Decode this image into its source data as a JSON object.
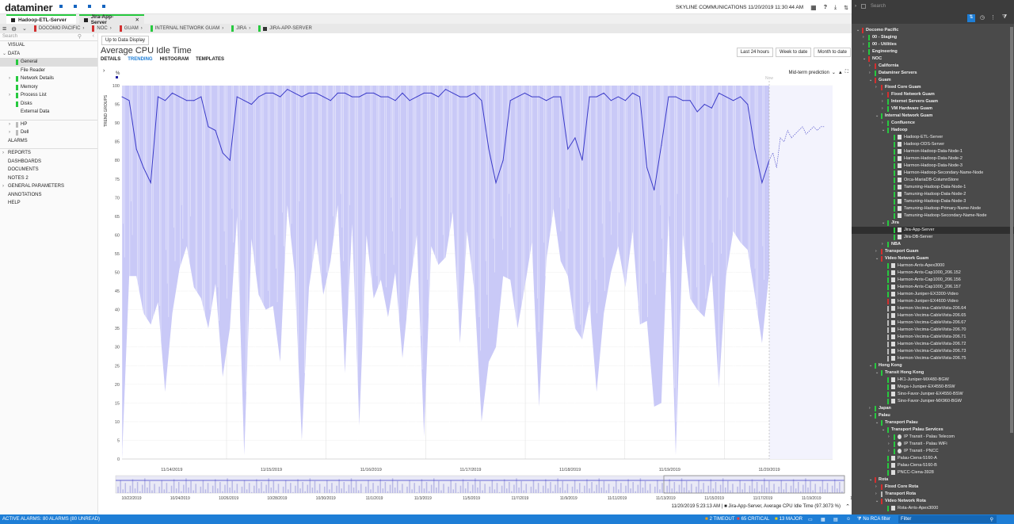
{
  "app": {
    "logo": "dataminer",
    "org_time": "SKYLINE COMMUNICATIONS 11/20/2019 11:30:44 AM"
  },
  "tabs": [
    {
      "label": "Hadoop-ETL-Server",
      "active": true
    },
    {
      "label": "Jira-App-Server",
      "active": false
    }
  ],
  "breadcrumbs": [
    "DOCOMO PACIFIC",
    "NOC",
    "GUAM",
    "INTERNAL NETWORK GUAM",
    "JIRA",
    "JIRA-APP-SERVER"
  ],
  "left_search": "Search",
  "left_nav": [
    {
      "label": "VISUAL",
      "indent": 0,
      "exp": "",
      "mark": ""
    },
    {
      "label": "DATA",
      "indent": 0,
      "exp": "⌄",
      "mark": ""
    },
    {
      "label": "General",
      "indent": 2,
      "exp": "",
      "mark": "#27c93f",
      "sel": true
    },
    {
      "label": "File Reader",
      "indent": 2,
      "exp": "",
      "mark": ""
    },
    {
      "label": "Network Details",
      "indent": 2,
      "exp": "›",
      "mark": "#27c93f"
    },
    {
      "label": "Memory",
      "indent": 2,
      "exp": "",
      "mark": "#27c93f"
    },
    {
      "label": "Process List",
      "indent": 2,
      "exp": "›",
      "mark": "#27c93f"
    },
    {
      "label": "Disks",
      "indent": 2,
      "exp": "",
      "mark": "#27c93f"
    },
    {
      "label": "External Data",
      "indent": 2,
      "exp": "",
      "mark": ""
    },
    {
      "label": "",
      "indent": 0,
      "exp": "",
      "mark": ""
    },
    {
      "label": "HP",
      "indent": 2,
      "exp": "›",
      "mark": "#bbb"
    },
    {
      "label": "Dell",
      "indent": 2,
      "exp": "›",
      "mark": "#bbb"
    },
    {
      "label": "ALARMS",
      "indent": 0,
      "exp": "",
      "mark": ""
    },
    {
      "label": "",
      "indent": 0,
      "exp": "",
      "mark": ""
    },
    {
      "label": "REPORTS",
      "indent": 0,
      "exp": "›",
      "mark": ""
    },
    {
      "label": "DASHBOARDS",
      "indent": 0,
      "exp": "",
      "mark": ""
    },
    {
      "label": "DOCUMENTS",
      "indent": 0,
      "exp": "",
      "mark": ""
    },
    {
      "label": "NOTES 2",
      "indent": 0,
      "exp": "",
      "mark": ""
    },
    {
      "label": "GENERAL PARAMETERS",
      "indent": 0,
      "exp": "›",
      "mark": ""
    },
    {
      "label": "ANNOTATIONS",
      "indent": 0,
      "exp": "",
      "mark": ""
    },
    {
      "label": "HELP",
      "indent": 0,
      "exp": "",
      "mark": ""
    }
  ],
  "toolbar": {
    "up_to_date": "Up to Data Display"
  },
  "page_title": "Average CPU Idle Time",
  "content_tabs": [
    "DETAILS",
    "TRENDING",
    "HISTOGRAM",
    "TEMPLATES"
  ],
  "range_buttons": [
    "Last 24 hours",
    "Week to date",
    "Month to date"
  ],
  "prediction": "Mid-term prediction",
  "trend_groups": "TREND GROUPS",
  "now": "Now",
  "chart_data": {
    "type": "line",
    "title": "",
    "ylabel": "%",
    "ylim": [
      0,
      100
    ],
    "yticks": [
      0,
      5,
      10,
      15,
      20,
      25,
      30,
      35,
      40,
      45,
      50,
      55,
      60,
      65,
      70,
      75,
      80,
      85,
      90,
      95,
      100
    ],
    "xticks": [
      "11/14/2019",
      "11/15/2019",
      "11/16/2019",
      "11/17/2019",
      "11/18/2019",
      "11/19/2019",
      "11/20/2019",
      "11/21/2019"
    ],
    "series": [
      {
        "name": "Jira-App-Server, Average CPU Idle Time",
        "color": "#3a3ac8",
        "values": [
          97,
          96,
          83,
          78,
          74,
          97,
          96,
          98,
          97,
          96,
          96,
          97,
          89,
          88,
          82,
          80,
          97,
          96,
          95,
          97,
          98,
          98,
          97,
          99,
          98,
          97,
          98,
          98,
          97,
          96,
          98,
          98,
          97,
          97,
          98,
          98,
          97,
          97,
          96,
          98,
          96,
          97,
          98,
          98,
          97,
          99,
          98,
          97,
          97,
          98,
          96,
          83,
          74,
          80,
          96,
          97,
          98,
          97,
          97,
          96,
          97,
          97,
          83,
          86,
          80,
          97,
          97,
          98,
          96,
          97,
          96,
          98,
          97,
          78,
          72,
          84,
          97,
          97,
          96,
          96,
          93,
          95,
          94,
          98,
          97,
          96,
          97,
          95,
          83,
          74,
          80
        ]
      }
    ],
    "prediction_values": [
      80,
      82,
      78,
      86,
      85,
      88,
      86,
      87,
      88,
      89,
      87,
      88,
      89,
      88,
      89,
      89
    ],
    "overview_ticks": [
      "10/22/2019",
      "10/24/2019",
      "10/26/2019",
      "10/28/2019",
      "10/30/2019",
      "11/1/2019",
      "11/3/2019",
      "11/5/2019",
      "11/7/2019",
      "11/9/2019",
      "11/11/2019",
      "11/13/2019",
      "11/15/2019",
      "11/17/2019",
      "11/19/2019",
      "11/21/2019"
    ]
  },
  "hover_info": "11/20/2019 5:23:13 AM | ■ Jira-App-Server, Average CPU Idle Time (97.3073 %)",
  "status": {
    "left": "ACTIVE ALARMS: 80 ALARMS (80 UNREAD)",
    "timeout": "2 TIMEOUT",
    "critical": "65 CRITICAL",
    "major": "13 MAJOR",
    "rca": "No RCA filter",
    "filter": "Filter"
  },
  "right_search": "Search",
  "right_tree": [
    {
      "label": "Docomo Pacific",
      "l": 0,
      "e": "⌄",
      "c": "#d32f2f",
      "b": 1
    },
    {
      "label": "00 - Staging",
      "l": 1,
      "e": "›",
      "c": "#27c93f",
      "b": 1
    },
    {
      "label": "00 - Utilities",
      "l": 1,
      "e": "›",
      "c": "#27c93f",
      "b": 1
    },
    {
      "label": "Engineering",
      "l": 1,
      "e": "›",
      "c": "#27c93f",
      "b": 1
    },
    {
      "label": "NOC",
      "l": 1,
      "e": "⌄",
      "c": "#d32f2f",
      "b": 1
    },
    {
      "label": "California",
      "l": 2,
      "e": "›",
      "c": "#d32f2f",
      "b": 1
    },
    {
      "label": "Dataminer Servers",
      "l": 2,
      "e": "›",
      "c": "#27c93f",
      "b": 1
    },
    {
      "label": "Guam",
      "l": 2,
      "e": "⌄",
      "c": "#d32f2f",
      "b": 1
    },
    {
      "label": "Fixed Core Guam",
      "l": 3,
      "e": "›",
      "c": "#d32f2f",
      "b": 1
    },
    {
      "label": "Fixed Network Guam",
      "l": 4,
      "e": "›",
      "c": "#d32f2f",
      "b": 1
    },
    {
      "label": "Internet Servers Guam",
      "l": 4,
      "e": "›",
      "c": "#27c93f",
      "b": 1
    },
    {
      "label": "VM Hardware Guam",
      "l": 4,
      "e": "›",
      "c": "#27c93f",
      "b": 1
    },
    {
      "label": "Internal Network Guam",
      "l": 3,
      "e": "⌄",
      "c": "#27c93f",
      "b": 1
    },
    {
      "label": "Confluence",
      "l": 4,
      "e": "›",
      "c": "#27c93f",
      "b": 1
    },
    {
      "label": "Hadoop",
      "l": 4,
      "e": "⌄",
      "c": "#27c93f",
      "b": 1
    },
    {
      "label": "Hadoop-ETL-Server",
      "l": 5,
      "e": "",
      "c": "#27c93f",
      "b": 0,
      "i": 1
    },
    {
      "label": "Hadoop-ODS-Server",
      "l": 5,
      "e": "",
      "c": "#27c93f",
      "b": 0,
      "i": 1
    },
    {
      "label": "Harmon-Hadoop-Data-Node-1",
      "l": 5,
      "e": "",
      "c": "#27c93f",
      "b": 0,
      "i": 1
    },
    {
      "label": "Harmon-Hadoop-Data-Node-2",
      "l": 5,
      "e": "",
      "c": "#27c93f",
      "b": 0,
      "i": 1
    },
    {
      "label": "Harmon-Hadoop-Data-Node-3",
      "l": 5,
      "e": "",
      "c": "#27c93f",
      "b": 0,
      "i": 1
    },
    {
      "label": "Harmon-Hadoop-Secondary-Name-Node",
      "l": 5,
      "e": "",
      "c": "#27c93f",
      "b": 0,
      "i": 1
    },
    {
      "label": "Orca-MariaDB-ColumnStore",
      "l": 5,
      "e": "",
      "c": "#27c93f",
      "b": 0,
      "i": 1
    },
    {
      "label": "Tamuning-Hadoop-Data-Node-1",
      "l": 5,
      "e": "",
      "c": "#27c93f",
      "b": 0,
      "i": 1
    },
    {
      "label": "Tamuning-Hadoop-Data-Node-2",
      "l": 5,
      "e": "",
      "c": "#27c93f",
      "b": 0,
      "i": 1
    },
    {
      "label": "Tamuning-Hadoop-Data-Node-3",
      "l": 5,
      "e": "",
      "c": "#27c93f",
      "b": 0,
      "i": 1
    },
    {
      "label": "Tamuning-Hadoop-Primary-Name-Node",
      "l": 5,
      "e": "",
      "c": "#27c93f",
      "b": 0,
      "i": 1
    },
    {
      "label": "Tamuning-Hadoop-Secondary-Name-Node",
      "l": 5,
      "e": "",
      "c": "#27c93f",
      "b": 0,
      "i": 1
    },
    {
      "label": "Jira",
      "l": 4,
      "e": "⌄",
      "c": "#27c93f",
      "b": 1
    },
    {
      "label": "Jira-App-Server",
      "l": 5,
      "e": "",
      "c": "#27c93f",
      "b": 0,
      "i": 1,
      "sel": 1
    },
    {
      "label": "Jira-DB-Server",
      "l": 5,
      "e": "",
      "c": "#27c93f",
      "b": 0,
      "i": 1
    },
    {
      "label": "NBA",
      "l": 4,
      "e": "›",
      "c": "#27c93f",
      "b": 1
    },
    {
      "label": "Transport Guam",
      "l": 3,
      "e": "›",
      "c": "#d32f2f",
      "b": 1
    },
    {
      "label": "Video Network Guam",
      "l": 3,
      "e": "⌄",
      "c": "#d32f2f",
      "b": 1
    },
    {
      "label": "Harmon-Arris-Apex3000",
      "l": 4,
      "e": "",
      "c": "#27c93f",
      "b": 0,
      "i": 1
    },
    {
      "label": "Harmon-Arris-Cap1000_206.152",
      "l": 4,
      "e": "",
      "c": "#27c93f",
      "b": 0,
      "i": 1
    },
    {
      "label": "Harmon-Arris-Cap1000_206.156",
      "l": 4,
      "e": "",
      "c": "#27c93f",
      "b": 0,
      "i": 1
    },
    {
      "label": "Harmon-Arris-Cap1000_206.157",
      "l": 4,
      "e": "",
      "c": "#27c93f",
      "b": 0,
      "i": 1
    },
    {
      "label": "Harmon-Juniper-EX3300-Video",
      "l": 4,
      "e": "",
      "c": "#27c93f",
      "b": 0,
      "i": 1
    },
    {
      "label": "Harmon-Juniper-EX4600-Video",
      "l": 4,
      "e": "",
      "c": "#d32f2f",
      "b": 0,
      "i": 1
    },
    {
      "label": "Harmon-Vecima-CableVista-206.64",
      "l": 4,
      "e": "",
      "c": "#bbb",
      "b": 0,
      "i": 1
    },
    {
      "label": "Harmon-Vecima-CableVista-206.65",
      "l": 4,
      "e": "",
      "c": "#bbb",
      "b": 0,
      "i": 1
    },
    {
      "label": "Harmon-Vecima-CableVista-206.67",
      "l": 4,
      "e": "",
      "c": "#bbb",
      "b": 0,
      "i": 1
    },
    {
      "label": "Harmon-Vecima-CableVista-206.70",
      "l": 4,
      "e": "",
      "c": "#bbb",
      "b": 0,
      "i": 1
    },
    {
      "label": "Harmon-Vecima-CableVista-206.71",
      "l": 4,
      "e": "",
      "c": "#bbb",
      "b": 0,
      "i": 1
    },
    {
      "label": "Harmon-Vecima-CableVista-206.72",
      "l": 4,
      "e": "",
      "c": "#bbb",
      "b": 0,
      "i": 1
    },
    {
      "label": "Harmon-Vecima-CableVista-206.73",
      "l": 4,
      "e": "",
      "c": "#bbb",
      "b": 0,
      "i": 1
    },
    {
      "label": "Harmon-Vecima-CableVista-206.75",
      "l": 4,
      "e": "",
      "c": "#bbb",
      "b": 0,
      "i": 1
    },
    {
      "label": "Hong Kong",
      "l": 2,
      "e": "⌄",
      "c": "#27c93f",
      "b": 1
    },
    {
      "label": "Transit Hong Kong",
      "l": 3,
      "e": "⌄",
      "c": "#27c93f",
      "b": 1
    },
    {
      "label": "HK1-Juniper-MX480-BGW",
      "l": 4,
      "e": "",
      "c": "#27c93f",
      "b": 0,
      "i": 1
    },
    {
      "label": "Mega-i-Juniper-EX4550-BSW",
      "l": 4,
      "e": "",
      "c": "#27c93f",
      "b": 0,
      "i": 1
    },
    {
      "label": "Sino-Favor-Juniper-EX4550-BSW",
      "l": 4,
      "e": "",
      "c": "#27c93f",
      "b": 0,
      "i": 1
    },
    {
      "label": "Sino-Favor-Juniper-MX960-BGW",
      "l": 4,
      "e": "",
      "c": "#27c93f",
      "b": 0,
      "i": 1
    },
    {
      "label": "Japan",
      "l": 2,
      "e": "›",
      "c": "#27c93f",
      "b": 1
    },
    {
      "label": "Palau",
      "l": 2,
      "e": "⌄",
      "c": "#27c93f",
      "b": 1
    },
    {
      "label": "Transport Palau",
      "l": 3,
      "e": "⌄",
      "c": "#27c93f",
      "b": 1
    },
    {
      "label": "Transport Palau Services",
      "l": 4,
      "e": "⌄",
      "c": "#27c93f",
      "b": 1
    },
    {
      "label": "IP Transit - Palau Telecom",
      "l": 5,
      "e": "›",
      "c": "#27c93f",
      "b": 0,
      "i": 2
    },
    {
      "label": "IP Transit - Palau WiFi",
      "l": 5,
      "e": "›",
      "c": "#27c93f",
      "b": 0,
      "i": 2
    },
    {
      "label": "IP Transit - PNCC",
      "l": 5,
      "e": "›",
      "c": "#27c93f",
      "b": 0,
      "i": 2
    },
    {
      "label": "Palau-Ciena-5160-A",
      "l": 4,
      "e": "",
      "c": "#27c93f",
      "b": 0,
      "i": 1
    },
    {
      "label": "Palau-Ciena-5160-B",
      "l": 4,
      "e": "",
      "c": "#27c93f",
      "b": 0,
      "i": 1
    },
    {
      "label": "PNCC-Ciena-3928",
      "l": 4,
      "e": "",
      "c": "#27c93f",
      "b": 0,
      "i": 1
    },
    {
      "label": "Rota",
      "l": 2,
      "e": "⌄",
      "c": "#d32f2f",
      "b": 1
    },
    {
      "label": "Fixed Core Rota",
      "l": 3,
      "e": "›",
      "c": "#d32f2f",
      "b": 1
    },
    {
      "label": "Transport Rota",
      "l": 3,
      "e": "›",
      "c": "#bbb",
      "b": 1
    },
    {
      "label": "Video Network Rota",
      "l": 3,
      "e": "⌄",
      "c": "#d32f2f",
      "b": 1
    },
    {
      "label": "Rota-Arris-Apex3000",
      "l": 4,
      "e": "",
      "c": "#27c93f",
      "b": 0,
      "i": 1
    }
  ]
}
